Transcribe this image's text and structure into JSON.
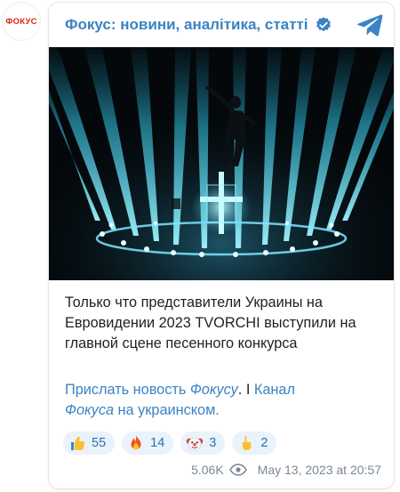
{
  "channel": {
    "avatar_text": "ФОКУС",
    "name": "Фокус: новини, аналітика, статті"
  },
  "post": {
    "message": "Только что представители Украины на Евровидении 2023 TVORCHI выступили на главной сцене песенного конкурса",
    "links": {
      "send_news": "Прислать новость ",
      "focus_italic": "Фокусу",
      "period": ".",
      "separator": " I ",
      "channel_word": "Канал",
      "focus_gen": "Фокуса",
      "in_ukrainian": " на украинском."
    },
    "reactions": [
      {
        "emoji": "thumbs-up",
        "count": "55"
      },
      {
        "emoji": "fire",
        "count": "14"
      },
      {
        "emoji": "clown",
        "count": "3"
      },
      {
        "emoji": "hand-pointing",
        "count": "2"
      }
    ],
    "views": "5.06K",
    "timestamp": "May 13, 2023 at 20:57"
  },
  "colors": {
    "accent": "#3b83c4",
    "reaction_bg": "#eaf2fb",
    "avatar_red": "#e2231a",
    "spotlight": "#5fe6ff"
  }
}
